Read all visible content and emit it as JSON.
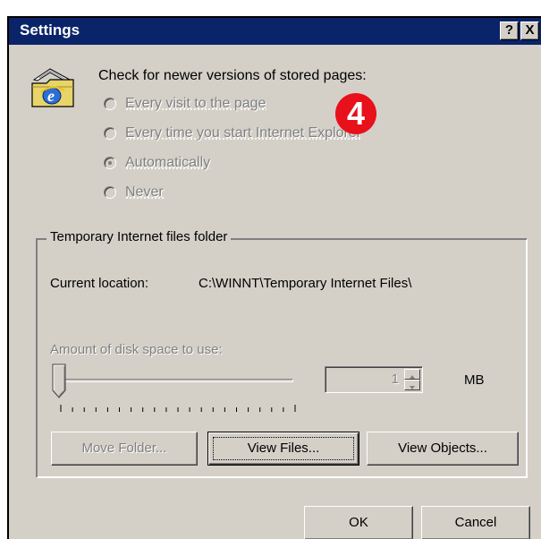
{
  "window": {
    "title": "Settings",
    "help_button": "?",
    "close_button": "X"
  },
  "check_newer": {
    "label": "Check for newer versions of stored pages:",
    "options": [
      {
        "label": "Every visit to the page",
        "selected": false,
        "enabled": false
      },
      {
        "label": "Every time you start Internet Explorer",
        "selected": false,
        "enabled": false
      },
      {
        "label": "Automatically",
        "selected": true,
        "enabled": false
      },
      {
        "label": "Never",
        "selected": false,
        "enabled": false
      }
    ]
  },
  "step_badge": "4",
  "temp_folder": {
    "group_title": "Temporary Internet files folder",
    "current_location_label": "Current location:",
    "current_location_value": "C:\\WINNT\\Temporary Internet Files\\",
    "disk_space_label": "Amount of disk space to use:",
    "disk_space_value": "1",
    "unit": "MB",
    "slider_level_percent": 0
  },
  "buttons": {
    "move_folder": "Move Folder...",
    "view_files": "View Files...",
    "view_objects": "View Objects...",
    "ok": "OK",
    "cancel": "Cancel"
  },
  "colors": {
    "titlebar": "#0a246a",
    "dialog_face": "#d4d0c8",
    "badge": "#e8101a"
  }
}
